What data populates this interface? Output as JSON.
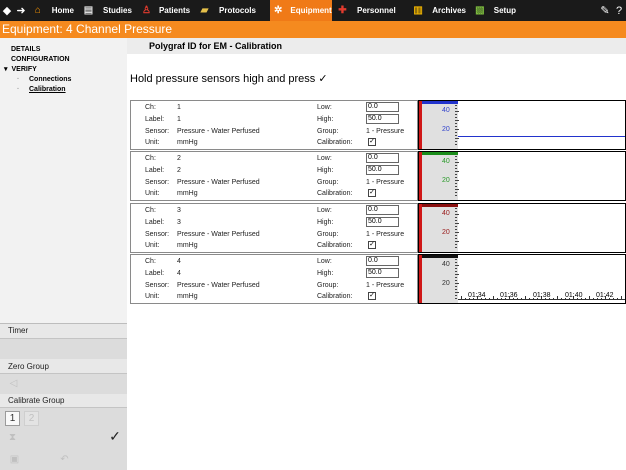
{
  "nav": {
    "back": "◆",
    "forward": "➜",
    "items": [
      {
        "label": "Home",
        "icon": "home-icon",
        "glyph": "⌂",
        "color": "#ff9900"
      },
      {
        "label": "Studies",
        "icon": "studies-icon",
        "glyph": "▤",
        "color": "#dddddd"
      },
      {
        "label": "Patients",
        "icon": "patients-icon",
        "glyph": "♙",
        "color": "#e23b2e"
      },
      {
        "label": "Protocols",
        "icon": "protocols-icon",
        "glyph": "▰",
        "color": "#e5c04a"
      },
      {
        "label": "Equipment",
        "icon": "equipment-icon",
        "glyph": "✲",
        "color": "#ffffff",
        "active": true
      },
      {
        "label": "Personnel",
        "icon": "personnel-icon",
        "glyph": "✚",
        "color": "#e23b2e"
      },
      {
        "label": "Archives",
        "icon": "archives-icon",
        "glyph": "▥",
        "color": "#f0b400"
      },
      {
        "label": "Setup",
        "icon": "setup-icon",
        "glyph": "▧",
        "color": "#7fbf3f"
      }
    ],
    "pencil_glyph": "✎",
    "help_glyph": "?"
  },
  "title": "Equipment: 4 Channel Pressure",
  "sidebar": {
    "tree": [
      {
        "label": "DETAILS",
        "level": 1
      },
      {
        "label": "CONFIGURATION",
        "level": 1
      },
      {
        "label": "VERIFY",
        "level": 1,
        "expanded": true
      },
      {
        "label": "Connections",
        "level": 2
      },
      {
        "label": "Calibration",
        "level": 2,
        "selected": true
      }
    ],
    "timer_label": "Timer",
    "zero_group_label": "Zero Group",
    "calibrate_group_label": "Calibrate Group",
    "group_buttons": [
      "1",
      "2"
    ],
    "zero_glyph": "◁",
    "hourglass_glyph": "⧗",
    "check_glyph": "✓",
    "save_glyph": "▣",
    "undo_glyph": "↶"
  },
  "main": {
    "breadcrumb": "Polygraf ID for EM - Calibration",
    "instruction": "Hold pressure sensors high and press ✓",
    "field_labels": {
      "ch": "Ch:",
      "label": "Label:",
      "sensor": "Sensor:",
      "unit": "Unit:",
      "low": "Low:",
      "high": "High:",
      "group": "Group:",
      "calibration": "Calibration:"
    },
    "channels": [
      {
        "ch": "1",
        "label": "1",
        "sensor": "Pressure - Water Perfused",
        "unit": "mmHg",
        "low": "0.0",
        "high": "50.0",
        "group": "1 - Pressure",
        "calibration_checked": true,
        "color": "#2233cc",
        "tick_color": "#3344cc",
        "ticks": [
          "40",
          "20"
        ],
        "trace_level": 0.1
      },
      {
        "ch": "2",
        "label": "2",
        "sensor": "Pressure - Water Perfused",
        "unit": "mmHg",
        "low": "0.0",
        "high": "50.0",
        "group": "1 - Pressure",
        "calibration_checked": true,
        "color": "#1a8c1a",
        "tick_color": "#2a9a2a",
        "ticks": [
          "40",
          "20"
        ]
      },
      {
        "ch": "3",
        "label": "3",
        "sensor": "Pressure - Water Perfused",
        "unit": "mmHg",
        "low": "0.0",
        "high": "50.0",
        "group": "1 - Pressure",
        "calibration_checked": true,
        "color": "#8a1010",
        "tick_color": "#991a1a",
        "ticks": [
          "40",
          "20"
        ]
      },
      {
        "ch": "4",
        "label": "4",
        "sensor": "Pressure - Water Perfused",
        "unit": "mmHg",
        "low": "0.0",
        "high": "50.0",
        "group": "1 - Pressure",
        "calibration_checked": true,
        "color": "#111111",
        "tick_color": "#333333",
        "ticks": [
          "40",
          "20"
        ]
      }
    ],
    "time_labels": [
      "01:34",
      "01:36",
      "01:38",
      "01:40",
      "01:42"
    ]
  }
}
